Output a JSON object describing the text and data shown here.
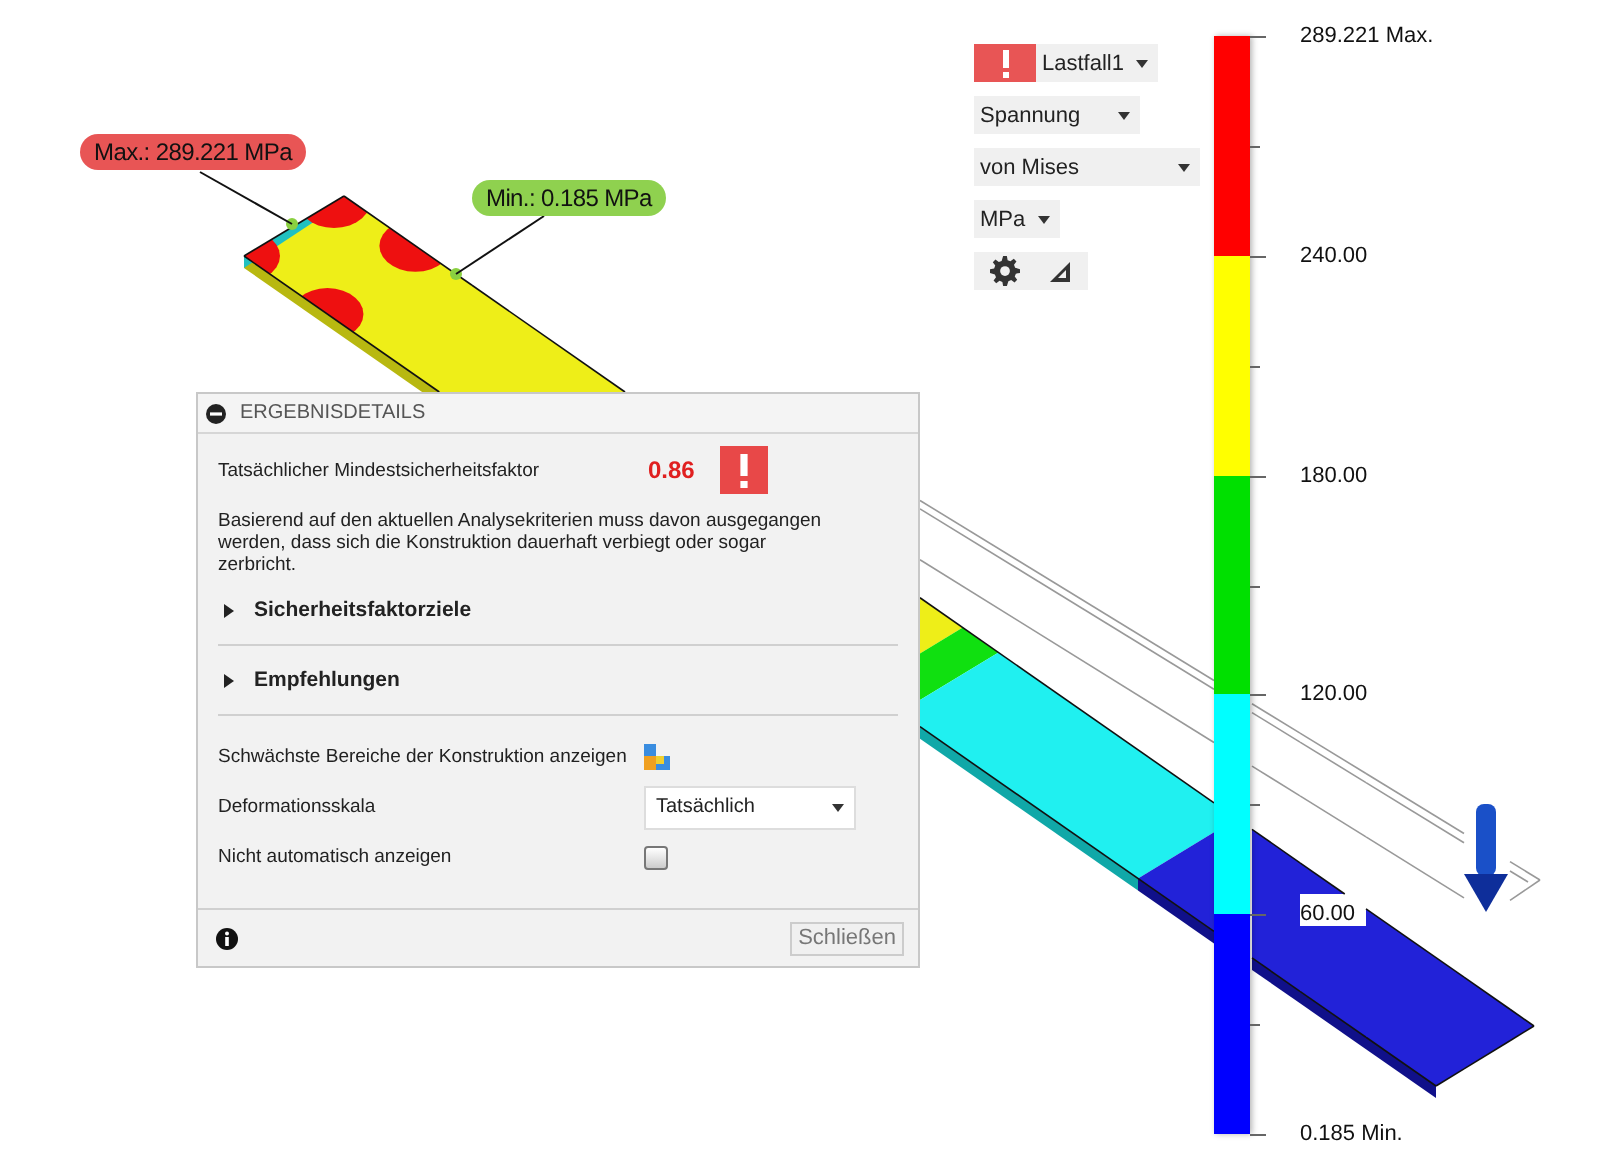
{
  "callouts": [
    {
      "kind": "max",
      "text": "Max.: 289.221 MPa"
    },
    {
      "kind": "min",
      "text": "Min.: 0.185 MPa"
    }
  ],
  "toolbar": {
    "load_case": "Lastfall1",
    "result_type": "Spannung",
    "component": "von Mises",
    "unit": "MPa"
  },
  "legend": {
    "bands": [
      {
        "color": "#ff0000"
      },
      {
        "color": "#ffff00"
      },
      {
        "color": "#00e000"
      },
      {
        "color": "#00ffff"
      },
      {
        "color": "#0000ff"
      }
    ],
    "labels": [
      "289.221 Max.",
      "240.00",
      "180.00",
      "120.00",
      "60.00",
      "0.185 Min."
    ]
  },
  "results_panel": {
    "title": "ERGEBNISDETAILS",
    "safety_factor_label": "Tatsächlicher Mindestsicherheitsfaktor",
    "safety_factor_value": "0.86",
    "message": "Basierend auf den aktuellen Analysekriterien muss davon ausgegangen werden, dass sich die Konstruktion dauerhaft verbiegt oder sogar zerbricht.",
    "sections": [
      {
        "label": "Sicherheitsfaktorziele",
        "expanded": false
      },
      {
        "label": "Empfehlungen",
        "expanded": false
      }
    ],
    "options": [
      {
        "kind": "icon-button",
        "label": "Schwächste Bereiche der Konstruktion anzeigen"
      },
      {
        "kind": "dropdown",
        "label": "Deformationsskala",
        "value": "Tatsächlich"
      },
      {
        "kind": "checkbox",
        "label": "Nicht automatisch anzeigen",
        "checked": false
      }
    ],
    "close_button": "Schließen"
  }
}
